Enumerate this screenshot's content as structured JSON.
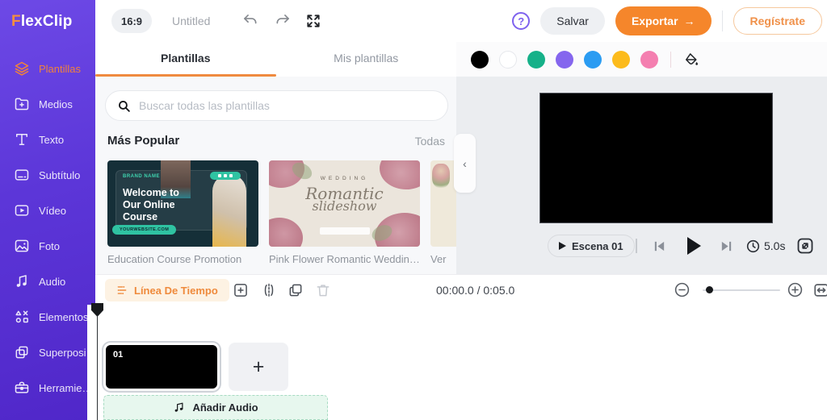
{
  "brand": {
    "first_letter": "F",
    "rest": "lexClip"
  },
  "topbar": {
    "aspect_ratio": "16:9",
    "project_title": "Untitled",
    "help": "?",
    "save": "Salvar",
    "export": "Exportar",
    "export_arrow": "→",
    "register": "Regístrate"
  },
  "sidebar": {
    "items": [
      {
        "label": "Plantillas"
      },
      {
        "label": "Medios"
      },
      {
        "label": "Texto"
      },
      {
        "label": "Subtítulo"
      },
      {
        "label": "Vídeo"
      },
      {
        "label": "Foto"
      },
      {
        "label": "Audio"
      },
      {
        "label": "Elementos"
      },
      {
        "label": "Superposi…"
      },
      {
        "label": "Herramie…"
      }
    ]
  },
  "tabs": {
    "active": "Plantillas",
    "inactive": "Mis plantillas"
  },
  "color_bar": {
    "swatches": [
      "#000000",
      "#ffffff",
      "#16b189",
      "#8566ee",
      "#2b9cf2",
      "#fcbb1c",
      "#f47fb0"
    ]
  },
  "templates_panel": {
    "search_placeholder": "Buscar todas las plantillas",
    "section_title": "Más Popular",
    "see_all": "Todas",
    "cards": [
      {
        "caption": "Education Course Promotion",
        "brand": "BRAND NAME",
        "headline1": "Welcome to",
        "headline2": "Our Online",
        "headline3": "Course",
        "badge": "YOURWEBSITE.COM"
      },
      {
        "caption": "Pink Flower Romantic Wedding …",
        "kicker": "WEDDING",
        "script1": "Romantic",
        "script2": "slideshow"
      },
      {
        "caption": "Ver"
      }
    ]
  },
  "preview": {
    "scene": "Escena 01",
    "duration": "5.0s"
  },
  "timeline": {
    "chip": "Línea De Tiempo",
    "time": "00:00.0 / 0:05.0",
    "clip_number": "01",
    "add_scene": "+",
    "add_audio": "Añadir Audio"
  },
  "accents": {
    "orange": "#f5862b",
    "sidebar_purple": "#5c36d8",
    "active_underline": "#ef8a3f"
  }
}
